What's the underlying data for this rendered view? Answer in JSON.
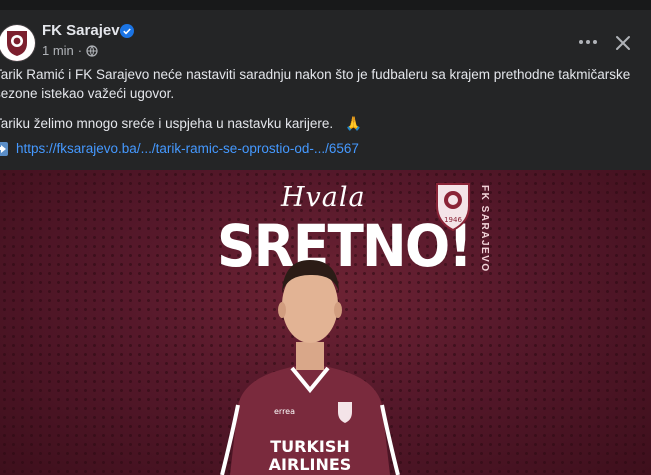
{
  "post": {
    "page_name": "FK Sarajevo",
    "time": "1 min",
    "separator": "·",
    "text_line1": "Tarik Ramić i FK Sarajevo neće nastaviti saradnju nakon što je fudbaleru sa krajem prethodne takmičarske",
    "text_line2": "sezone istekao važeći ugovor.",
    "text_line3": "Tariku želimo mnogo sreće i uspjeha u nastavku karijere.",
    "emoji": "🙏",
    "link": "https://fksarajevo.ba/.../tarik-ramic-se-oprostio-od-.../6567"
  },
  "graphic": {
    "hvala": "Hvala",
    "sretno": "SRETNO!",
    "club_vertical": "FK SARAJEVO",
    "logo_year": "1946",
    "sponsor_line1": "TURKISH",
    "sponsor_line2": "AIRLINES",
    "kit_brand": "errea"
  },
  "icons": {
    "verified": "verified-badge-icon",
    "globe": "globe-icon",
    "more": "more-options-icon",
    "close": "close-icon",
    "link_arrow": "arrow-right-icon"
  },
  "colors": {
    "background": "#242526",
    "link": "#4599ff",
    "maroon": "#6d2334",
    "verified": "#1b74e4"
  }
}
